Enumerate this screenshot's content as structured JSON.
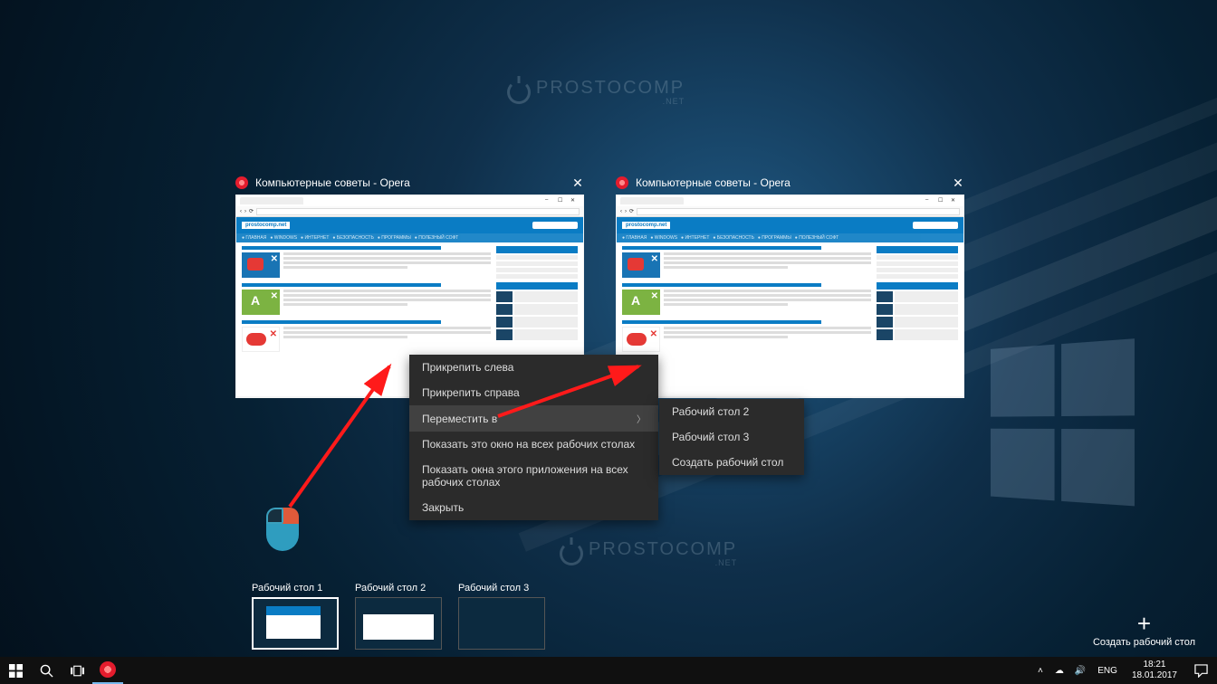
{
  "watermark": {
    "brand": "ProstoComp",
    "sub": ".net"
  },
  "previews": {
    "left": {
      "title": "Компьютерные советы - Opera",
      "site_logo": "prostocomp.net"
    },
    "right": {
      "title": "Компьютерные советы - Opera",
      "site_logo": "prostocomp.net"
    }
  },
  "context_menu": {
    "items": [
      {
        "label": "Прикрепить слева"
      },
      {
        "label": "Прикрепить справа"
      },
      {
        "label": "Переместить в",
        "submenu": true,
        "hover": true
      },
      {
        "label": "Показать это окно на всех рабочих столах"
      },
      {
        "label": "Показать окна этого приложения на всех рабочих столах"
      },
      {
        "label": "Закрыть"
      }
    ],
    "submenu": [
      {
        "label": "Рабочий стол 2"
      },
      {
        "label": "Рабочий стол 3"
      },
      {
        "label": "Создать рабочий стол"
      }
    ]
  },
  "virtual_desktops": {
    "items": [
      {
        "label": "Рабочий стол 1",
        "active": true
      },
      {
        "label": "Рабочий стол 2"
      },
      {
        "label": "Рабочий стол 3"
      }
    ],
    "new_label": "Создать рабочий стол"
  },
  "taskbar": {
    "tray": {
      "volume": "🔊",
      "lang": "ENG",
      "time": "18:21",
      "date": "18.01.2017"
    }
  }
}
